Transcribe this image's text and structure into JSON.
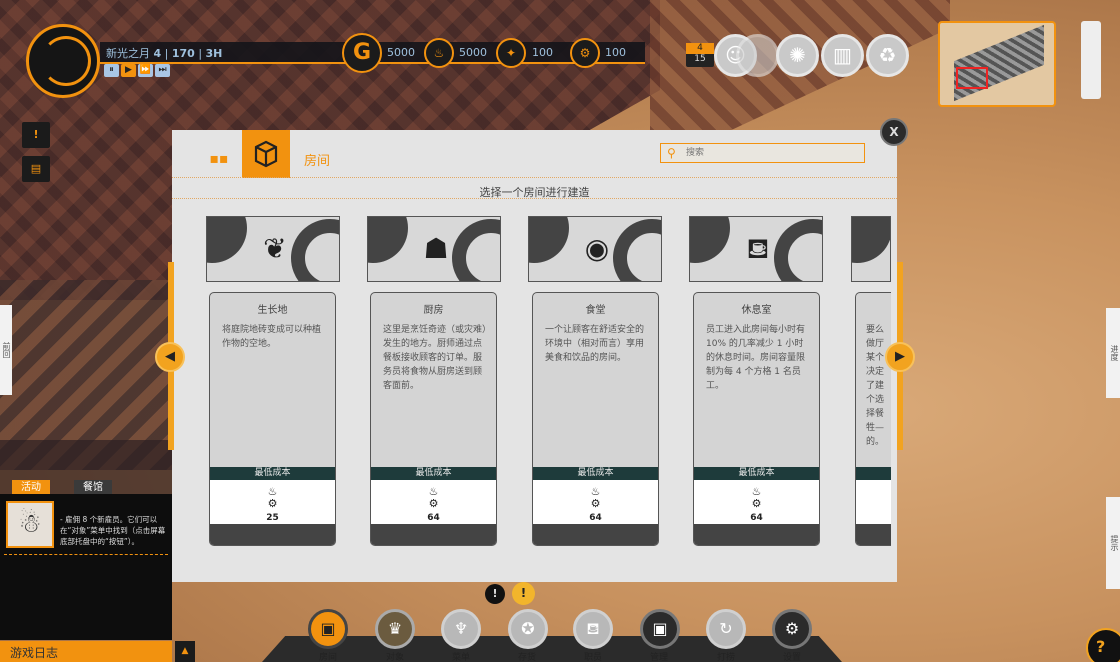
{
  "hud": {
    "date_label": "新光之月",
    "day": "4",
    "population": "170",
    "time": "3H",
    "speed_controls": [
      "⏸",
      "▶",
      "⏩",
      "⏭"
    ],
    "resources": [
      {
        "icon": "gold-icon",
        "value": "5000"
      },
      {
        "icon": "food-icon",
        "value": "5000"
      },
      {
        "icon": "power-icon",
        "value": "100"
      },
      {
        "icon": "gear-icon",
        "value": "100"
      }
    ],
    "badge_top": "4",
    "badge_bottom": "15"
  },
  "modal": {
    "tab_label": "房间",
    "search_placeholder": "搜索",
    "subtitle": "选择一个房间进行建造",
    "close_label": "X",
    "cost_label": "最低成本",
    "cards": [
      {
        "title": "生长地",
        "desc": "将庭院地砖变成可以种植作物的空地。",
        "cost": "25",
        "icon": "plant-hand-icon"
      },
      {
        "title": "厨房",
        "desc": "这里是烹饪奇迹（或灾难）发生的地方。厨师通过点餐板接收顾客的订单。服务员将食物从厨房送到顾客面前。",
        "cost": "64",
        "icon": "chef-icon"
      },
      {
        "title": "食堂",
        "desc": "一个让顾客在舒适安全的环境中（相对而言）享用美食和饮品的房间。",
        "cost": "64",
        "icon": "plate-icon"
      },
      {
        "title": "休息室",
        "desc": "员工进入此房间每小时有 10% 的几率减少 1 小时的休息时间。房间容量限制为每 4 个方格 1 名员工。",
        "cost": "64",
        "icon": "sofa-icon"
      },
      {
        "title": "",
        "desc": "要么做厅某个决定了建个选择餐牲—的。",
        "cost": "",
        "icon": "partial-icon"
      }
    ]
  },
  "log": {
    "tabs": [
      "活动",
      "餐馆"
    ],
    "message": "- 雇佣 8 个新雇员。它们可以在“对象”菜单中找到（点击屏幕底部托盘中的“按钮”）。",
    "footer": "游戏日志"
  },
  "toolbar": [
    {
      "label": "房间",
      "icon": "box-icon"
    },
    {
      "label": "对象",
      "icon": "chair-icon"
    },
    {
      "label": "菜单",
      "icon": "fork-knife-icon"
    },
    {
      "label": "存货",
      "icon": "crate-icon"
    },
    {
      "label": "职员",
      "icon": "sofa-staff-icon"
    },
    {
      "label": "管理",
      "icon": "manage-icon"
    },
    {
      "label": "打捞",
      "icon": "salvage-icon"
    },
    {
      "label": "设置",
      "icon": "settings-icon"
    }
  ],
  "edge_labels": {
    "left": "前回",
    "right_top": "进度",
    "right_bottom": "提示"
  }
}
